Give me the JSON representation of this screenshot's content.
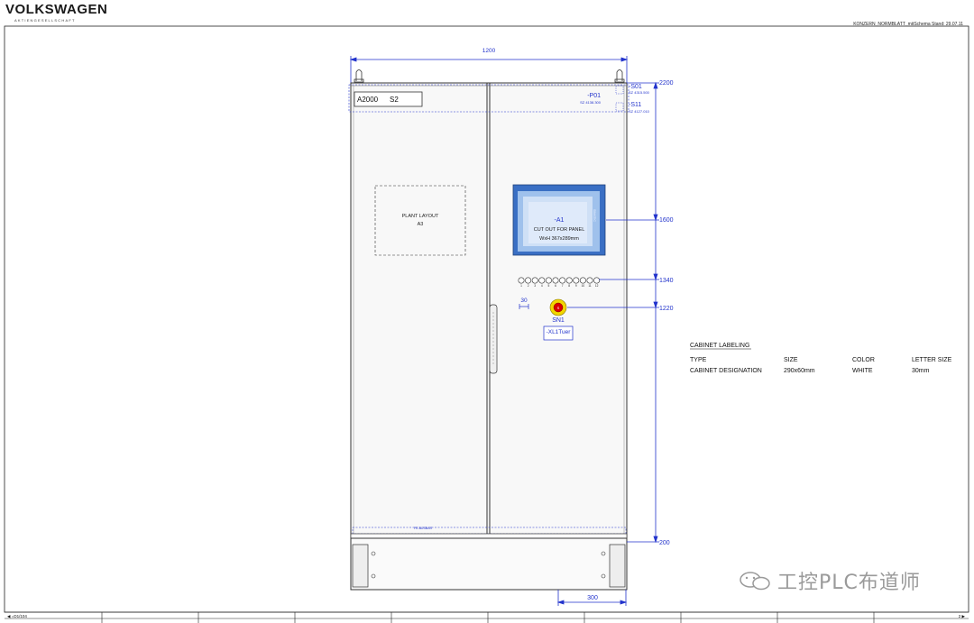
{
  "header": {
    "brand": "VOLKSWAGEN",
    "brand_sub": "AKTIENGESELLSCHAFT",
    "doc_info": "KONZERN_NORMBLATT_mitSchema   Stand:   29.07.11"
  },
  "dimensions": {
    "width": "1200",
    "h_2200": "2200",
    "h_1600": "1600",
    "h_1340": "1340",
    "h_1220": "1220",
    "h_200": "200",
    "plinth_width": "300",
    "spacing_30": "30"
  },
  "cabinet": {
    "label_id": "A2000",
    "label_s": "S2",
    "p01": "-P01",
    "p01_ref": "SZ 4138.300",
    "s01": "-S01",
    "s01_ref": "SZ 4315.500",
    "s11": "-S11",
    "s11_ref": "SZ 4127.010",
    "plant_layout_1": "PLANT LAYOUT",
    "plant_layout_2": "A3",
    "hmi_id": "-A1",
    "hmi_line1": "CUT OUT FOR PANEL",
    "hmi_line2": "WxH 367x289mm",
    "lamp_numbers": [
      "1",
      "2",
      "3",
      "4",
      "5",
      "6",
      "7",
      "8",
      "9",
      "10",
      "11",
      "12"
    ],
    "estop_id": "SN1",
    "estop_label": "-XL1Tuer",
    "pe_busbar": "PE-BUSBAR"
  },
  "labeling_table": {
    "title": "CABINET LABELING",
    "headers": [
      "TYPE",
      "SIZE",
      "COLOR",
      "LETTER SIZE"
    ],
    "rows": [
      [
        "CABINET DESIGNATION",
        "290x60mm",
        "WHITE",
        "30mm"
      ]
    ]
  },
  "footer": {
    "left": "◀ =D1/104",
    "right": "2 ▶"
  },
  "watermark": "工控PLC布道师",
  "colors": {
    "dim_blue": "#2233cc",
    "hmi_outer": "#3a6fc4",
    "hmi_inner": "#9fc1ec",
    "hmi_screen": "#dfeafa",
    "estop_ring": "#f2d600",
    "estop_red": "#d90000"
  }
}
